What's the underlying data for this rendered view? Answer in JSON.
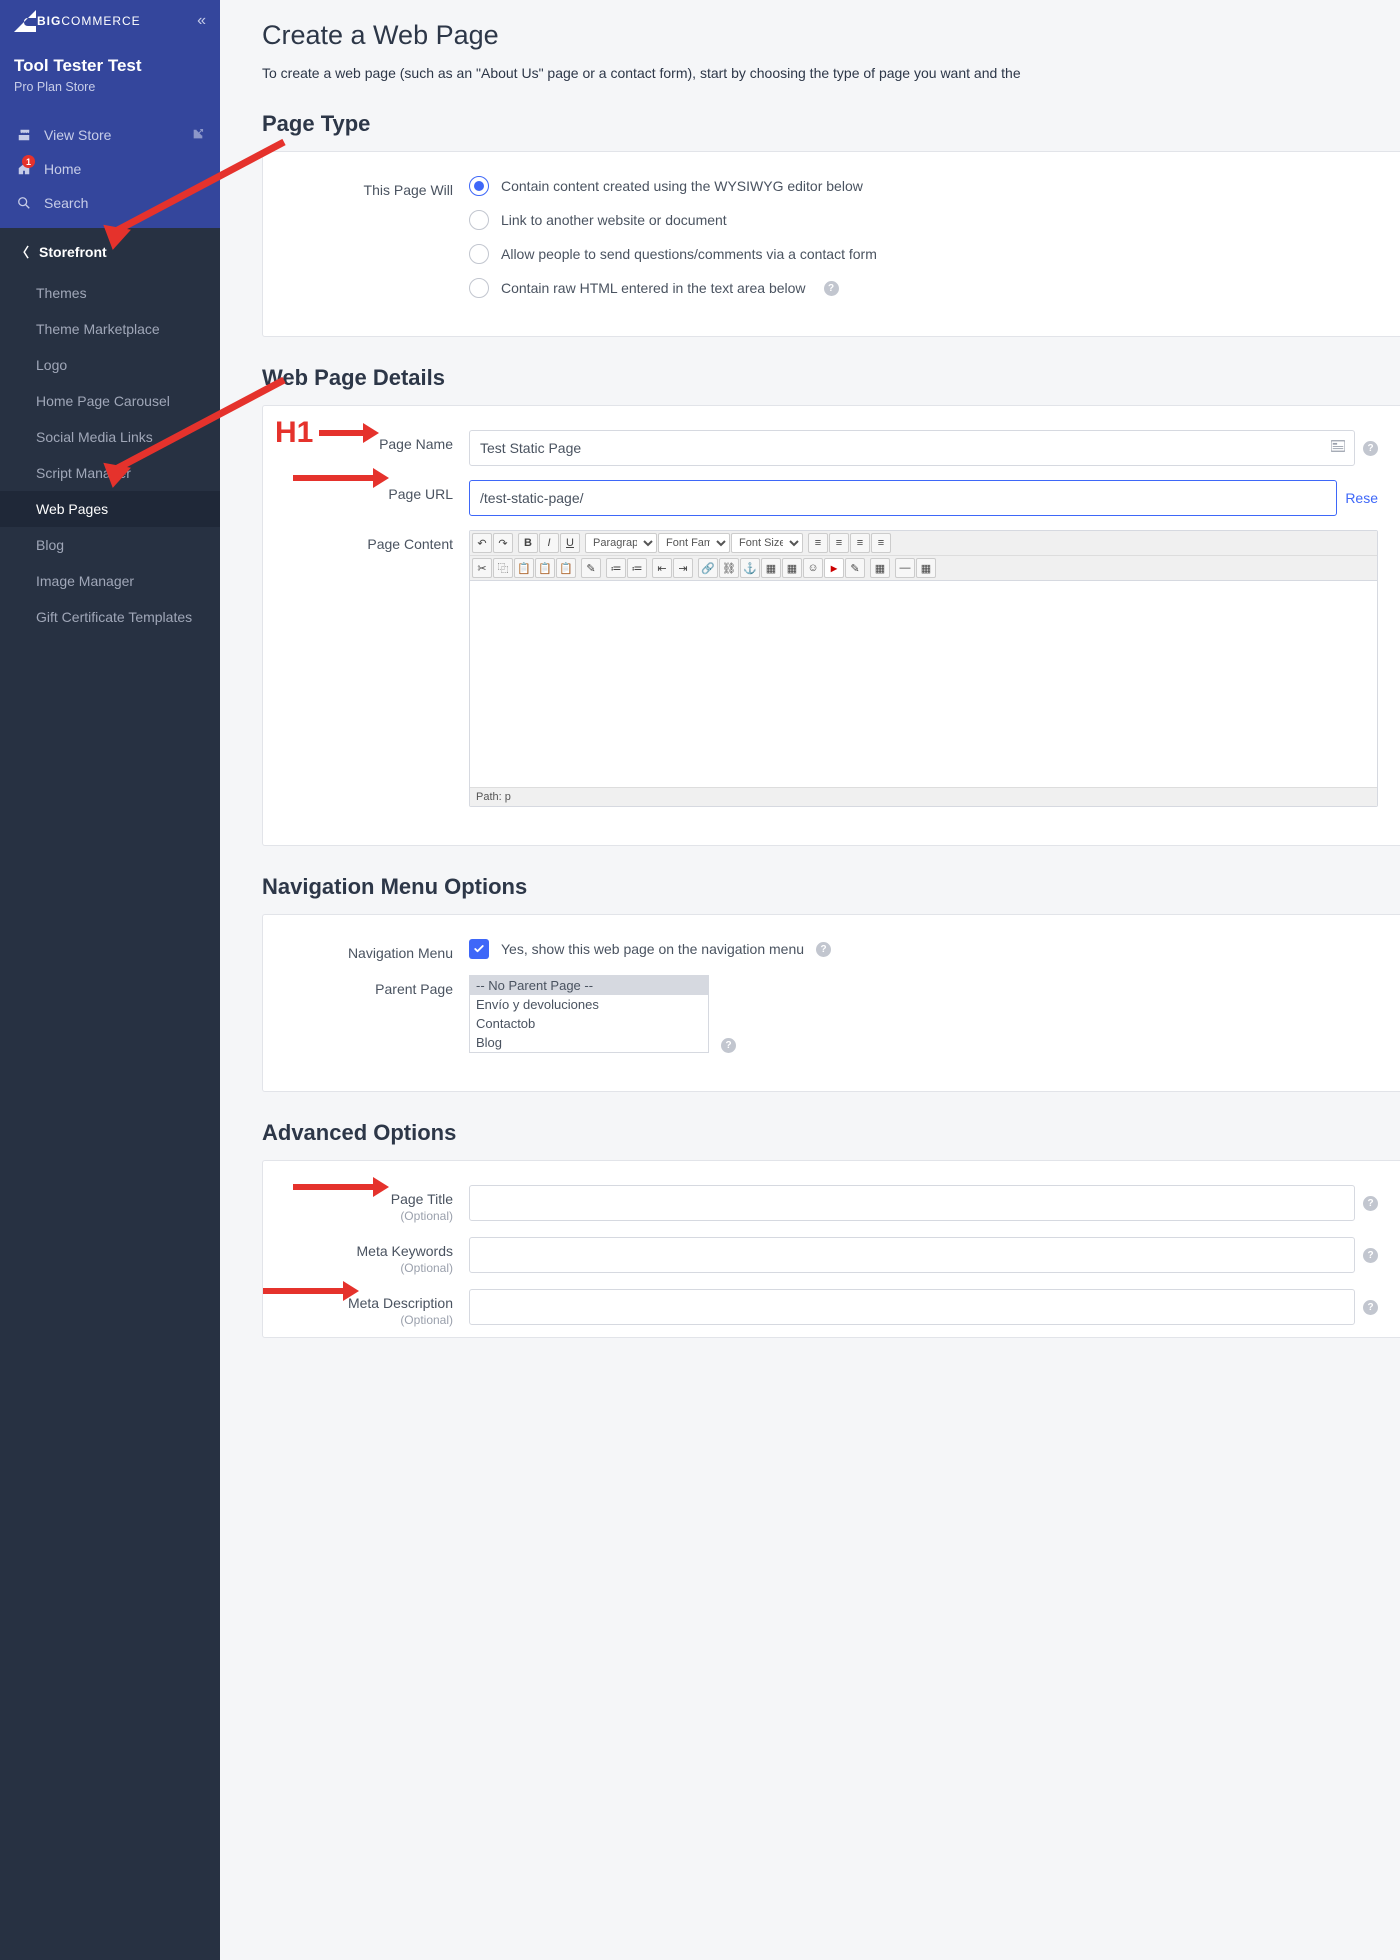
{
  "brand": {
    "big": "BIG",
    "commerce": "COMMERCE"
  },
  "store": {
    "name": "Tool Tester Test",
    "plan": "Pro Plan Store"
  },
  "navTop": {
    "viewStore": "View Store",
    "home": "Home",
    "homeBadge": "1",
    "search": "Search"
  },
  "sidebar": {
    "header": "Storefront",
    "items": [
      "Themes",
      "Theme Marketplace",
      "Logo",
      "Home Page Carousel",
      "Social Media Links",
      "Script Manager",
      "Web Pages",
      "Blog",
      "Image Manager",
      "Gift Certificate Templates"
    ],
    "activeIndex": 6
  },
  "page": {
    "title": "Create a Web Page",
    "desc": "To create a web page (such as an \"About Us\" page or a contact form), start by choosing the type of page you want and the"
  },
  "sections": {
    "pageType": {
      "title": "Page Type",
      "label": "This Page Will",
      "options": [
        "Contain content created using the WYSIWYG editor below",
        "Link to another website or document",
        "Allow people to send questions/comments via a contact form",
        "Contain raw HTML entered in the text area below"
      ],
      "selectedIndex": 0
    },
    "details": {
      "title": "Web Page Details",
      "pageNameLabel": "Page Name",
      "pageNameValue": "Test Static Page",
      "pageUrlLabel": "Page URL",
      "pageUrlValue": "/test-static-page/",
      "resetLabel": "Rese",
      "pageContentLabel": "Page Content",
      "editor": {
        "paragraph": "Paragraph",
        "fontFamily": "Font Family",
        "fontSize": "Font Size",
        "path": "Path: p"
      }
    },
    "navMenu": {
      "title": "Navigation Menu Options",
      "label": "Navigation Menu",
      "checkboxText": "Yes, show this web page on the navigation menu",
      "parentLabel": "Parent Page",
      "options": [
        "-- No Parent Page --",
        "Envío y devoluciones",
        "Contactob",
        "Blog"
      ],
      "selectedIndex": 0
    },
    "advanced": {
      "title": "Advanced Options",
      "pageTitleLabel": "Page Title",
      "metaKeywordsLabel": "Meta Keywords",
      "metaDescLabel": "Meta Description",
      "optional": "(Optional)"
    }
  },
  "annotations": {
    "h1": "H1"
  }
}
